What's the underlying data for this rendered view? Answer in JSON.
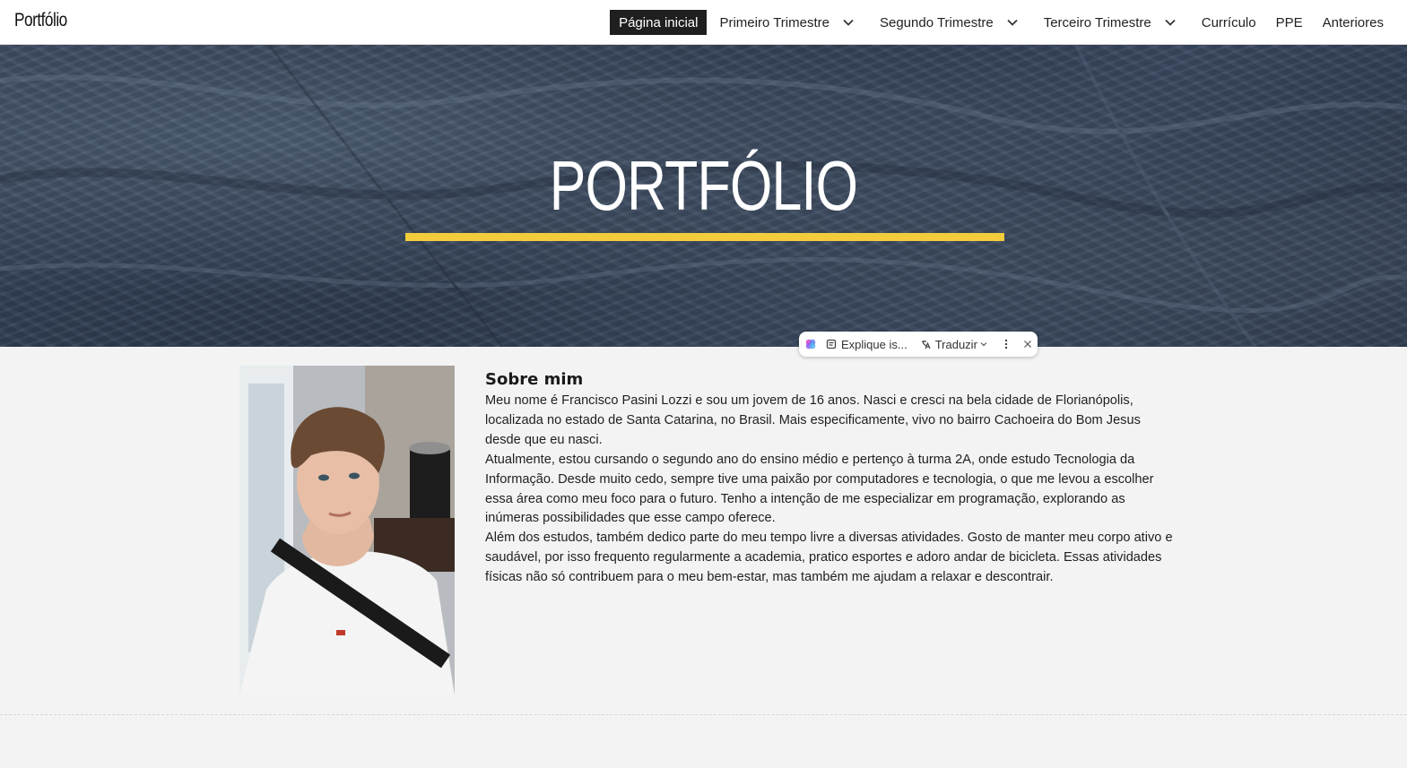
{
  "header": {
    "site_title": "Portfólio",
    "nav": [
      {
        "label": "Página inicial",
        "active": true,
        "dropdown": false
      },
      {
        "label": "Primeiro Trimestre",
        "active": false,
        "dropdown": true
      },
      {
        "label": "Segundo Trimestre",
        "active": false,
        "dropdown": true
      },
      {
        "label": "Terceiro Trimestre",
        "active": false,
        "dropdown": true
      },
      {
        "label": "Currículo",
        "active": false,
        "dropdown": false
      },
      {
        "label": "PPE",
        "active": false,
        "dropdown": false
      },
      {
        "label": "Anteriores",
        "active": false,
        "dropdown": false
      }
    ]
  },
  "hero": {
    "title": "PORTFÓLIO",
    "accent_color": "#f2cc3b"
  },
  "floating_toolbar": {
    "explain_label": "Explique is...",
    "translate_label": "Traduzir"
  },
  "about": {
    "heading": "Sobre mim",
    "paragraphs": [
      "Meu nome é Francisco Pasini Lozzi e sou um jovem de 16 anos. Nasci e cresci na bela cidade de Florianópolis, localizada no estado de Santa Catarina, no Brasil. Mais especificamente, vivo no bairro Cachoeira do Bom Jesus desde que eu nasci.",
      "Atualmente, estou cursando o segundo ano do ensino médio e pertenço à turma 2A, onde estudo Tecnologia da Informação. Desde muito cedo, sempre tive uma paixão por computadores e tecnologia, o que me levou a escolher essa área como meu foco para o futuro. Tenho a intenção de me especializar em programação, explorando as inúmeras possibilidades que esse campo oferece.",
      "Além dos estudos, também dedico parte do meu tempo livre a diversas atividades. Gosto de manter meu corpo ativo e saudável, por isso frequento regularmente a academia, pratico esportes e adoro andar de bicicleta. Essas atividades físicas não só contribuem para o meu bem-estar, mas também me ajudam a relaxar e descontrair."
    ]
  }
}
